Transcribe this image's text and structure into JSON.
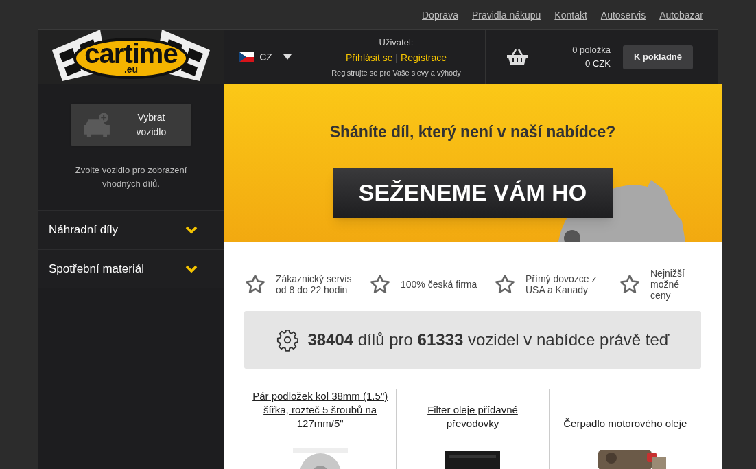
{
  "top_links": [
    "Doprava",
    "Pravidla nákupu",
    "Kontakt",
    "Autoservis",
    "Autobazar"
  ],
  "logo": {
    "name": "cartime",
    "domain": ".eu"
  },
  "language": {
    "code": "CZ"
  },
  "user": {
    "label": "Uživatel:",
    "login": "Přihlásit se",
    "separator": "|",
    "register": "Registrace",
    "note": "Registrujte se pro Vaše slevy a výhody"
  },
  "cart": {
    "items": "0 položka",
    "total": "0 CZK",
    "checkout": "K pokladně"
  },
  "sidebar": {
    "vehicle_button": "Vybrat vozidlo",
    "hint": "Zvolte vozidlo pro zobrazení vhodných dílů.",
    "categories": [
      {
        "label": "Náhradní díly",
        "expanded": false
      },
      {
        "label": "Spotřební materiál",
        "expanded": false
      }
    ]
  },
  "banner": {
    "question": "Sháníte díl, který není v naší nabídce?",
    "cta": "SEŽENEME VÁM HO"
  },
  "features": [
    "Zákaznický servis od 8 do 22 hodin",
    "100% česká firma",
    "Přímý dovozce z USA a Kanady",
    "Nejnižší možné ceny"
  ],
  "stats": "**38404** dílů pro **61333** vozidel v nabídce právě teď",
  "products": [
    {
      "title": "Pár podložek kol 38mm (1.5\") šířka, rozteč 5 šroubů na 127mm/5\"",
      "kind": "picture"
    },
    {
      "title": "Filter oleje přídavné převodovky",
      "kind": "picture"
    },
    {
      "title": "Čerpadlo motorového oleje",
      "kind": "picture"
    }
  ]
}
